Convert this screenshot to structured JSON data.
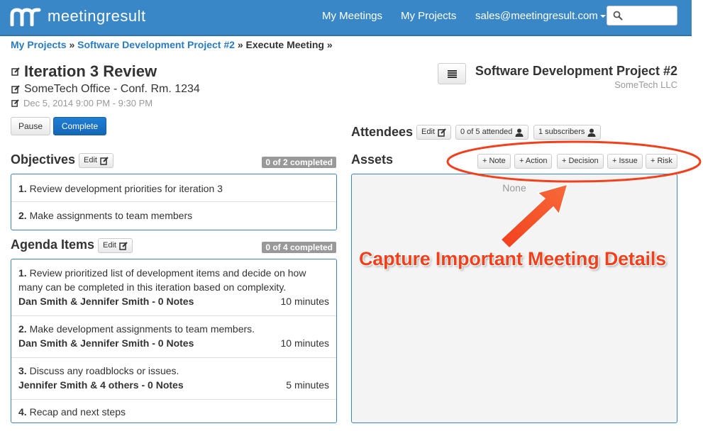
{
  "nav": {
    "brand": "meetingresult",
    "my_meetings": "My Meetings",
    "my_projects": "My Projects",
    "user_email": "sales@meetingresult.com",
    "search_placeholder": ""
  },
  "breadcrumb": {
    "items": [
      "My Projects",
      "Software Development Project #2",
      "Execute Meeting"
    ],
    "separator": "»"
  },
  "meeting": {
    "title": "Iteration 3 Review",
    "location": "SomeTech Office - Conf. Rm. 1234",
    "datetime": "Dec 5, 2014 9:00 PM - 9:30 PM",
    "pause_label": "Pause",
    "complete_label": "Complete"
  },
  "project": {
    "name": "Software Development Project #2",
    "company": "SomeTech LLC"
  },
  "objectives": {
    "title": "Objectives",
    "edit_label": "Edit",
    "badge": "0 of 2 completed",
    "items": [
      {
        "num": "1.",
        "text": "Review development priorities for iteration 3"
      },
      {
        "num": "2.",
        "text": "Make assignments to team members"
      }
    ]
  },
  "agenda": {
    "title": "Agenda Items",
    "edit_label": "Edit",
    "badge": "0 of 4 completed",
    "items": [
      {
        "num": "1.",
        "text1": "Review prioritized list of development items and decide on how",
        "text2": "many can be completed in this iteration based on complexity.",
        "who": "Dan Smith & Jennifer Smith - 0 Notes",
        "duration": "10 minutes"
      },
      {
        "num": "2.",
        "text1": "Make development assignments to team members.",
        "who": "Dan Smith & Jennifer Smith - 0 Notes",
        "duration": "10 minutes"
      },
      {
        "num": "3.",
        "text1": "Discuss any roadblocks or issues.",
        "who": "Jennifer Smith & 4 others - 0 Notes",
        "duration": "5 minutes"
      },
      {
        "num": "4.",
        "text1": "Recap and next steps"
      }
    ]
  },
  "attendees": {
    "title": "Attendees",
    "edit_label": "Edit",
    "attended": "0 of 5 attended",
    "subscribers": "1 subscribers"
  },
  "assets": {
    "title": "Assets",
    "buttons": [
      "+ Note",
      "+ Action",
      "+ Decision",
      "+ Issue",
      "+ Risk"
    ],
    "empty": "None"
  },
  "annotation": {
    "text": "Capture Important Meeting Details",
    "color": "#f2401c"
  },
  "colors": {
    "navbar": "#3a87c8",
    "link": "#2a7bbf",
    "primary_button": "#1a72c4",
    "badge": "#999999"
  }
}
